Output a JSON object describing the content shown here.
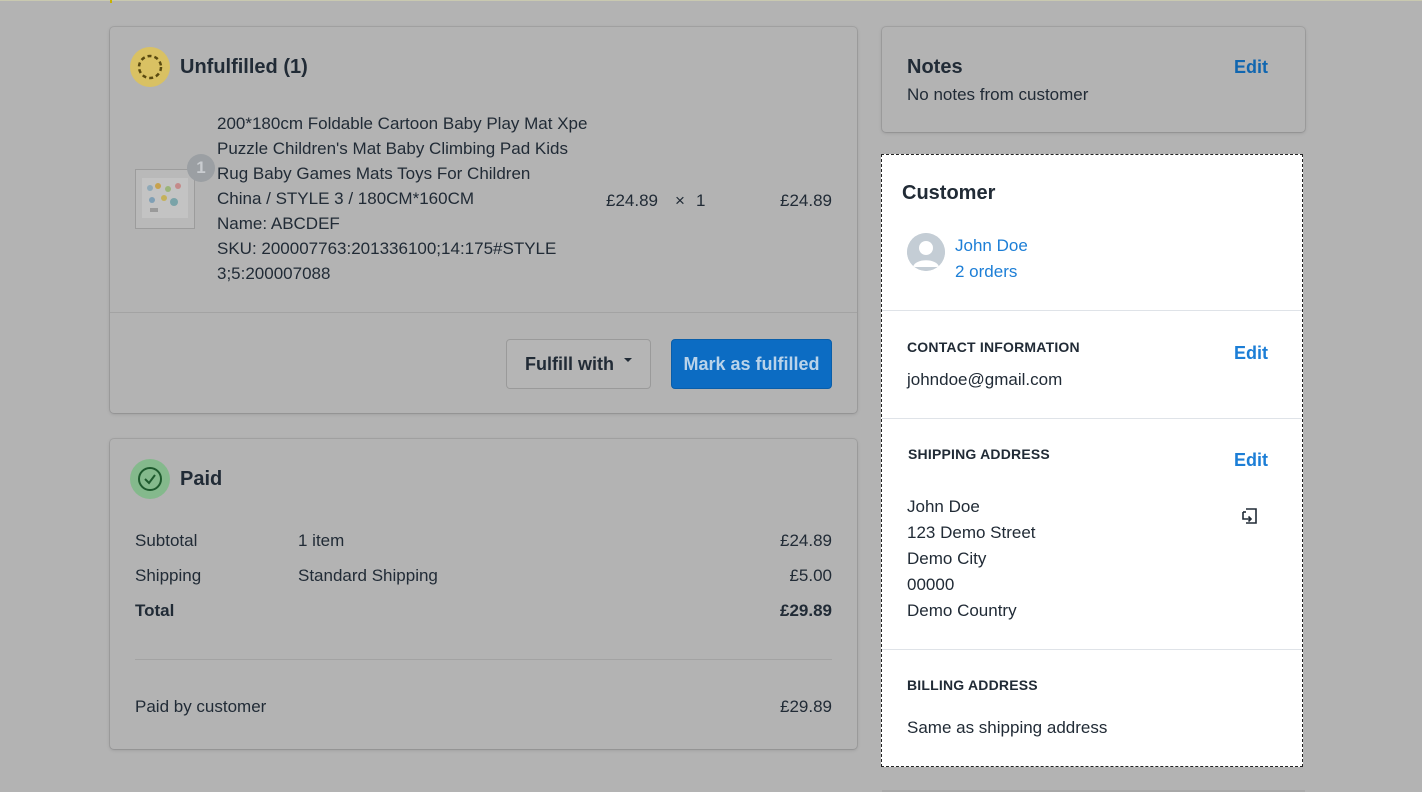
{
  "unfulfilled": {
    "title": "Unfulfilled (1)",
    "product": {
      "name_line1": "200*180cm Foldable Cartoon Baby Play Mat Xpe",
      "name_line2": "Puzzle Children's Mat Baby Climbing Pad Kids",
      "name_line3": "Rug Baby Games Mats Toys For Children",
      "variant": "China / STYLE 3 / 180CM*160CM",
      "name_field": "Name: ABCDEF",
      "sku_line1": "SKU: 200007763:201336100;14:175#STYLE",
      "sku_line2": "3;5:200007088",
      "quantity_badge": "1",
      "unit_price": "£24.89",
      "times": "×",
      "quantity": "1",
      "line_total": "£24.89"
    },
    "fulfill_with_label": "Fulfill with",
    "mark_fulfilled_label": "Mark as fulfilled"
  },
  "paid": {
    "title": "Paid",
    "rows": [
      {
        "label": "Subtotal",
        "desc": "1 item",
        "amount": "£24.89"
      },
      {
        "label": "Shipping",
        "desc": "Standard Shipping",
        "amount": "£5.00"
      },
      {
        "label": "Total",
        "desc": "",
        "amount": "£29.89"
      }
    ],
    "paid_by_label": "Paid by customer",
    "paid_by_amount": "£29.89"
  },
  "notes": {
    "title": "Notes",
    "edit_label": "Edit",
    "text": "No notes from customer"
  },
  "customer": {
    "title": "Customer",
    "name": "John Doe",
    "orders": "2 orders",
    "contact": {
      "heading": "CONTACT INFORMATION",
      "edit_label": "Edit",
      "email": "johndoe@gmail.com"
    },
    "shipping": {
      "heading": "SHIPPING ADDRESS",
      "edit_label": "Edit",
      "lines": [
        "John Doe",
        "123 Demo Street",
        "Demo City",
        "00000",
        "Demo Country"
      ]
    },
    "billing": {
      "heading": "BILLING ADDRESS",
      "text": "Same as shipping address"
    }
  },
  "icons": {
    "unfulfilled": "unfulfilled-status-icon",
    "paid": "checkmark-circle-icon",
    "avatar": "avatar-icon",
    "copy": "copy-icon",
    "caret": "caret-down-icon"
  },
  "colors": {
    "link": "#1267a8",
    "primary_button": "#0b6fc6",
    "unfulfilled_badge": "#e0c54f",
    "paid_badge": "#7fbf8a"
  }
}
